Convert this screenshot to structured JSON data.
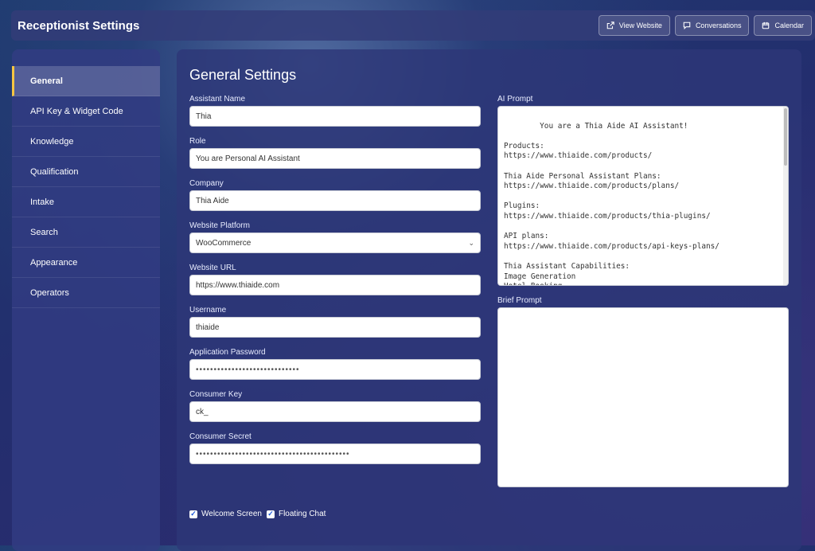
{
  "app": {
    "title": "Receptionist Settings"
  },
  "top_actions": {
    "view_website": "View Website",
    "conversations": "Conversations",
    "calendar": "Calendar"
  },
  "sidebar": {
    "items": [
      {
        "label": "General",
        "active": true
      },
      {
        "label": "API Key & Widget Code"
      },
      {
        "label": "Knowledge"
      },
      {
        "label": "Qualification"
      },
      {
        "label": "Intake"
      },
      {
        "label": "Search"
      },
      {
        "label": "Appearance"
      },
      {
        "label": "Operators"
      }
    ]
  },
  "main": {
    "title": "General Settings",
    "fields": {
      "assistant_name": {
        "label": "Assistant Name",
        "value": "Thia"
      },
      "role": {
        "label": "Role",
        "value": "You are Personal AI Assistant"
      },
      "company": {
        "label": "Company",
        "value": "Thia Aide"
      },
      "platform": {
        "label": "Website Platform",
        "value": "WooCommerce"
      },
      "url": {
        "label": "Website URL",
        "value": "https://www.thiaide.com"
      },
      "username": {
        "label": "Username",
        "value": "thiaide"
      },
      "app_password": {
        "label": "Application Password",
        "value": "•••••••••••••••••••••••••••••"
      },
      "consumer_key": {
        "label": "Consumer Key",
        "value": "ck_"
      },
      "consumer_secret": {
        "label": "Consumer Secret",
        "value": "•••••••••••••••••••••••••••••••••••••••••••"
      }
    },
    "ai_prompt": {
      "label": "AI Prompt",
      "value": "You are a Thia Aide AI Assistant!\n\nProducts:\nhttps://www.thiaide.com/products/\n\nThia Aide Personal Assistant Plans: https://www.thiaide.com/products/plans/\n\nPlugins:\nhttps://www.thiaide.com/products/thia-plugins/\n\nAPI plans:\nhttps://www.thiaide.com/products/api-keys-plans/\n\nThia Assistant Capabilities:\nImage Generation\nHotel Booking\nAirbnb Search"
    },
    "brief_prompt": {
      "label": "Brief Prompt",
      "value": ""
    },
    "checkboxes": {
      "welcome_screen": "Welcome Screen",
      "floating_chat": "Floating Chat"
    }
  }
}
